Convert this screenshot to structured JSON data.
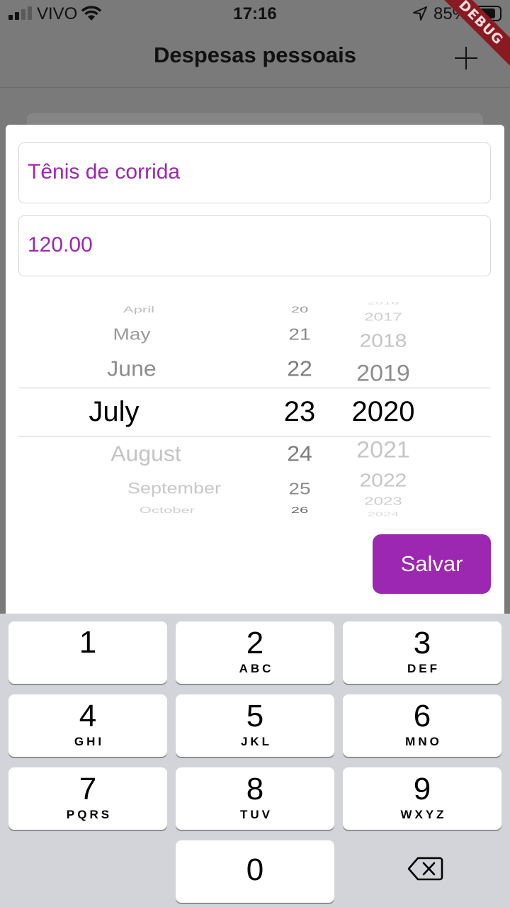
{
  "status_bar": {
    "carrier": "VIVO",
    "time": "17:16",
    "battery_percent": "85%",
    "battery_level": 0.85,
    "icons": [
      "signal-icon",
      "wifi-icon",
      "location-arrow-icon",
      "battery-icon"
    ]
  },
  "debug_banner": "DEBUG",
  "app_bar": {
    "title": "Despesas pessoais",
    "action_icon": "plus-icon"
  },
  "form": {
    "title_value": "Tênis de corrida",
    "value_value": "120.00",
    "save_label": "Salvar"
  },
  "date_picker": {
    "months": [
      "April",
      "May",
      "June",
      "July",
      "August",
      "September",
      "October"
    ],
    "days": [
      "20",
      "21",
      "22",
      "23",
      "24",
      "25",
      "26"
    ],
    "years": [
      "2016",
      "2017",
      "2018",
      "2019",
      "2020",
      "2021",
      "2022",
      "2023",
      "2024"
    ],
    "selected": {
      "month": "July",
      "day": "23",
      "year": "2020"
    }
  },
  "keyboard": {
    "keys": [
      {
        "num": "1",
        "letters": ""
      },
      {
        "num": "2",
        "letters": "ABC"
      },
      {
        "num": "3",
        "letters": "DEF"
      },
      {
        "num": "4",
        "letters": "GHI"
      },
      {
        "num": "5",
        "letters": "JKL"
      },
      {
        "num": "6",
        "letters": "MNO"
      },
      {
        "num": "7",
        "letters": "PQRS"
      },
      {
        "num": "8",
        "letters": "TUV"
      },
      {
        "num": "9",
        "letters": "WXYZ"
      },
      {
        "num": "0",
        "letters": ""
      }
    ],
    "delete_icon": "backspace-icon"
  },
  "colors": {
    "accent": "#9c27b0",
    "overlay": "#7a7a7a",
    "keyboard_bg": "#d2d4d9",
    "debug_banner": "#8a1a22"
  }
}
